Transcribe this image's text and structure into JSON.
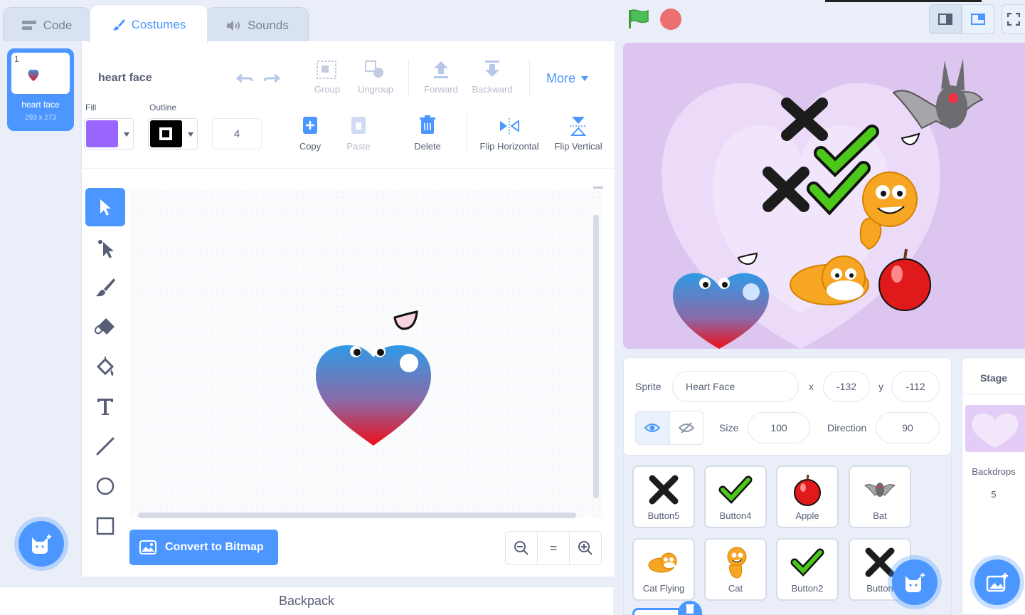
{
  "tabs": [
    {
      "label": "Code",
      "icon": "code-icon"
    },
    {
      "label": "Costumes",
      "icon": "brush-icon"
    },
    {
      "label": "Sounds",
      "icon": "speaker-icon"
    }
  ],
  "costume": {
    "number": "1",
    "name": "heart face",
    "size": "293 x 273"
  },
  "editor": {
    "name_value": "heart face",
    "fill_label": "Fill",
    "outline_label": "Outline",
    "outline_width": "4",
    "fill_color": "#9966ff",
    "outline_color": "#000000",
    "group": "Group",
    "ungroup": "Ungroup",
    "forward": "Forward",
    "backward": "Backward",
    "more": "More",
    "copy": "Copy",
    "paste": "Paste",
    "delete": "Delete",
    "flip_h": "Flip Horizontal",
    "flip_v": "Flip Vertical",
    "convert": "Convert to Bitmap",
    "zoom_reset": "="
  },
  "backpack": "Backpack",
  "sprite_info": {
    "sprite_label": "Sprite",
    "sprite_name": "Heart Face",
    "x_label": "x",
    "x": "-132",
    "y_label": "y",
    "y": "-112",
    "size_label": "Size",
    "size": "100",
    "direction_label": "Direction",
    "direction": "90"
  },
  "sprites": [
    {
      "name": "Button5"
    },
    {
      "name": "Button4"
    },
    {
      "name": "Apple"
    },
    {
      "name": "Bat"
    },
    {
      "name": "Cat Flying"
    },
    {
      "name": "Cat"
    },
    {
      "name": "Button2"
    },
    {
      "name": "Button"
    }
  ],
  "stage_panel": {
    "title": "Stage",
    "backdrops_label": "Backdrops",
    "backdrops_count": "5"
  },
  "colors": {
    "accent": "#4c97ff",
    "green_flag": "#4cbf56",
    "stop": "#ec5959"
  }
}
